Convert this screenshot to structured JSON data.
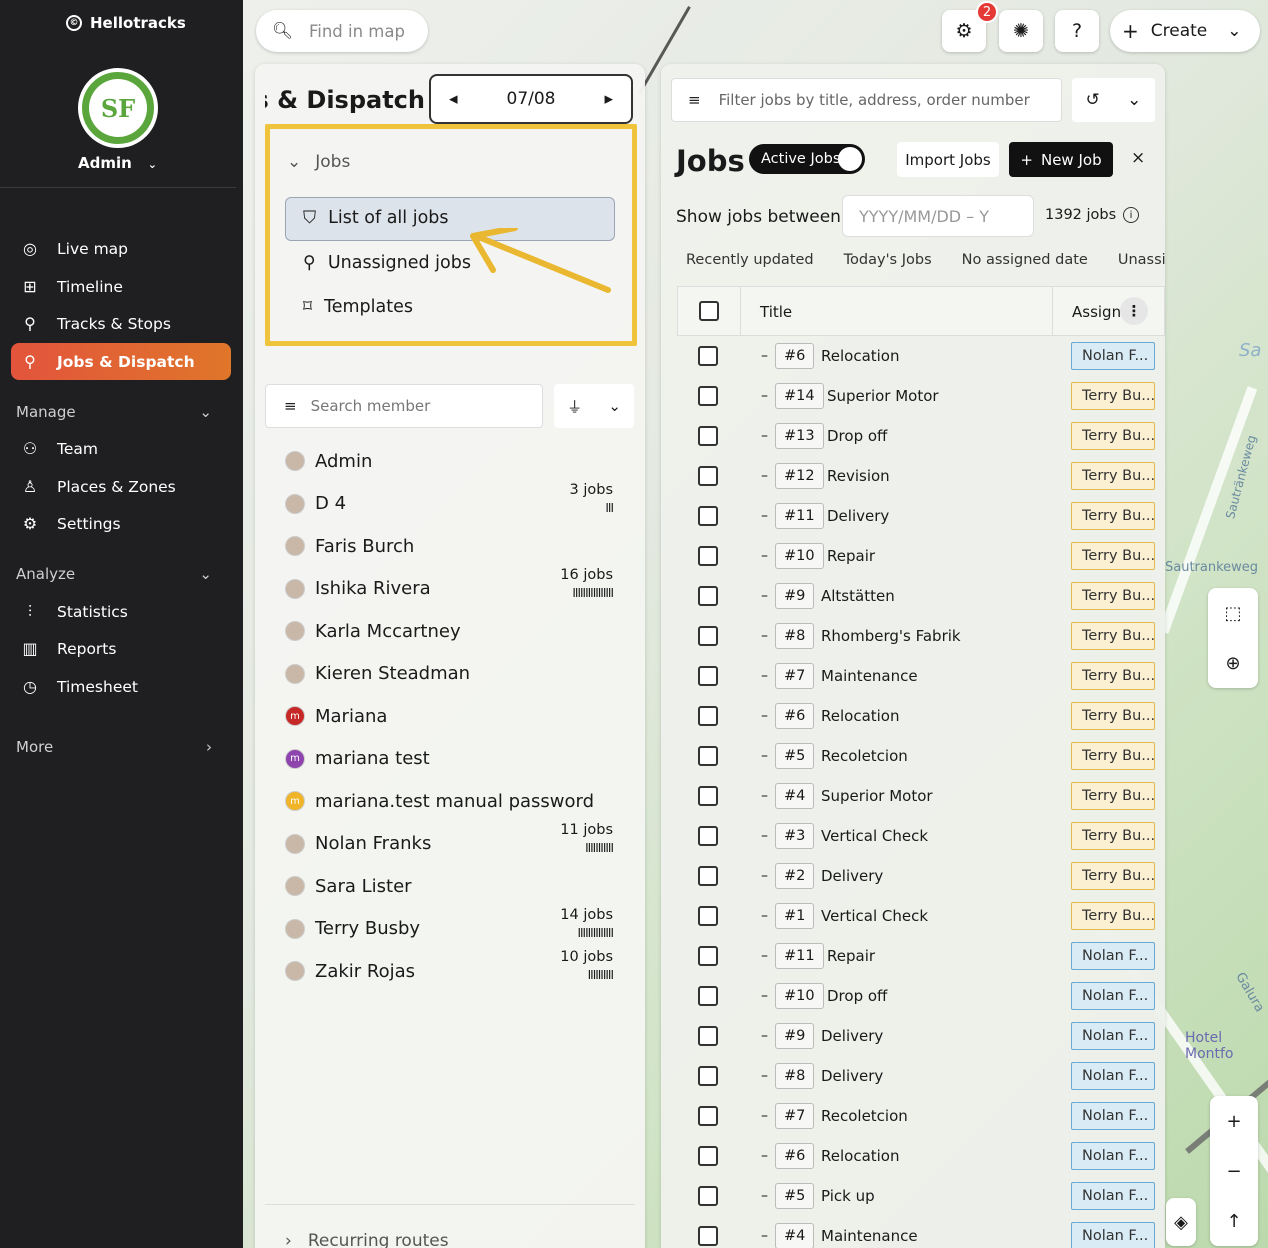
{
  "app": {
    "brand": "Hellotracks",
    "user": "Admin",
    "avatar_initials": "SF"
  },
  "sidebar": {
    "items": [
      {
        "label": "Live map",
        "icon": "live-map-icon"
      },
      {
        "label": "Timeline",
        "icon": "timeline-icon"
      },
      {
        "label": "Tracks & Stops",
        "icon": "tracks-icon"
      },
      {
        "label": "Jobs & Dispatch",
        "icon": "jobs-icon"
      }
    ],
    "manage_label": "Manage",
    "manage_items": [
      {
        "label": "Team",
        "icon": "team-icon"
      },
      {
        "label": "Places & Zones",
        "icon": "places-icon"
      },
      {
        "label": "Settings",
        "icon": "gear-icon"
      }
    ],
    "analyze_label": "Analyze",
    "analyze_items": [
      {
        "label": "Statistics",
        "icon": "statistics-icon"
      },
      {
        "label": "Reports",
        "icon": "reports-icon"
      },
      {
        "label": "Timesheet",
        "icon": "timesheet-icon"
      }
    ],
    "more_label": "More"
  },
  "topbar": {
    "search_placeholder": "Find in map",
    "notif_count": "2",
    "help": "?",
    "create_label": "Create"
  },
  "left_panel": {
    "title": "Jobs & Dispatch",
    "date": "07/08",
    "jobs_section": "Jobs",
    "menu": [
      "List of all jobs",
      "Unassigned jobs",
      "Templates"
    ],
    "search_placeholder": "Search member",
    "members": [
      {
        "name": "Admin",
        "jobs": ""
      },
      {
        "name": "D 4",
        "jobs": "3 jobs",
        "bars": "III"
      },
      {
        "name": "Faris Burch",
        "jobs": ""
      },
      {
        "name": "Ishika Rivera",
        "jobs": "16 jobs",
        "bars": "IIIIIIIIIIIIIIII"
      },
      {
        "name": "Karla Mccartney",
        "jobs": ""
      },
      {
        "name": "Kieren Steadman",
        "jobs": ""
      },
      {
        "name": "Mariana",
        "jobs": "",
        "initial": "m",
        "color": "#c62828"
      },
      {
        "name": "mariana test",
        "jobs": "",
        "initial": "m",
        "color": "#8e44ad"
      },
      {
        "name": "mariana.test manual password",
        "jobs": "",
        "initial": "m",
        "color": "#f0b429"
      },
      {
        "name": "Nolan Franks",
        "jobs": "11 jobs",
        "bars": "IIIIIIIIIII"
      },
      {
        "name": "Sara Lister",
        "jobs": ""
      },
      {
        "name": "Terry Busby",
        "jobs": "14 jobs",
        "bars": "IIIIIIIIIIIIII"
      },
      {
        "name": "Zakir Rojas",
        "jobs": "10 jobs",
        "bars": "IIIIIIIIII"
      }
    ],
    "recurring": "Recurring routes"
  },
  "right_panel": {
    "filter_placeholder": "Filter jobs by title, address, order number",
    "title": "Jobs",
    "toggle": "Active Jobs",
    "import": "Import Jobs",
    "new_job": "New Job",
    "show_between": "Show jobs between",
    "date_placeholder": "YYYY/MM/DD – Y",
    "count": "1392 jobs",
    "tabs": [
      "Recently updated",
      "Today's Jobs",
      "No assigned date",
      "Unassigne"
    ],
    "columns": {
      "title": "Title",
      "assign": "Assign"
    },
    "rows": [
      {
        "num": "#6",
        "title": "Relocation",
        "assignee": "Nolan F...",
        "who": "nolan"
      },
      {
        "num": "#14",
        "title": "Superior Motor",
        "assignee": "Terry Bu...",
        "who": "terry"
      },
      {
        "num": "#13",
        "title": "Drop off",
        "assignee": "Terry Bu...",
        "who": "terry"
      },
      {
        "num": "#12",
        "title": "Revision",
        "assignee": "Terry Bu...",
        "who": "terry"
      },
      {
        "num": "#11",
        "title": "Delivery",
        "assignee": "Terry Bu...",
        "who": "terry"
      },
      {
        "num": "#10",
        "title": "Repair",
        "assignee": "Terry Bu...",
        "who": "terry"
      },
      {
        "num": "#9",
        "title": "Altstätten",
        "assignee": "Terry Bu...",
        "who": "terry"
      },
      {
        "num": "#8",
        "title": "Rhomberg's Fabrik",
        "assignee": "Terry Bu...",
        "who": "terry"
      },
      {
        "num": "#7",
        "title": "Maintenance",
        "assignee": "Terry Bu...",
        "who": "terry"
      },
      {
        "num": "#6",
        "title": "Relocation",
        "assignee": "Terry Bu...",
        "who": "terry"
      },
      {
        "num": "#5",
        "title": "Recoletcion",
        "assignee": "Terry Bu...",
        "who": "terry"
      },
      {
        "num": "#4",
        "title": "Superior Motor",
        "assignee": "Terry Bu...",
        "who": "terry"
      },
      {
        "num": "#3",
        "title": "Vertical Check",
        "assignee": "Terry Bu...",
        "who": "terry"
      },
      {
        "num": "#2",
        "title": "Delivery",
        "assignee": "Terry Bu...",
        "who": "terry"
      },
      {
        "num": "#1",
        "title": "Vertical Check",
        "assignee": "Terry Bu...",
        "who": "terry"
      },
      {
        "num": "#11",
        "title": "Repair",
        "assignee": "Nolan F...",
        "who": "nolan"
      },
      {
        "num": "#10",
        "title": "Drop off",
        "assignee": "Nolan F...",
        "who": "nolan"
      },
      {
        "num": "#9",
        "title": "Delivery",
        "assignee": "Nolan F...",
        "who": "nolan"
      },
      {
        "num": "#8",
        "title": "Delivery",
        "assignee": "Nolan F...",
        "who": "nolan"
      },
      {
        "num": "#7",
        "title": "Recoletcion",
        "assignee": "Nolan F...",
        "who": "nolan"
      },
      {
        "num": "#6",
        "title": "Relocation",
        "assignee": "Nolan F...",
        "who": "nolan"
      },
      {
        "num": "#5",
        "title": "Pick up",
        "assignee": "Nolan F...",
        "who": "nolan"
      },
      {
        "num": "#4",
        "title": "Maintenance",
        "assignee": "Nolan F...",
        "who": "nolan"
      }
    ]
  },
  "map_labels": [
    "Sautränkeweg",
    "Sautrankeweg",
    "Hotel Montfo",
    "Galura",
    "Sa"
  ],
  "colors": {
    "accent": "#e0622f",
    "highlight": "#f0c33c",
    "nolan": "#d9ecf6",
    "terry": "#fbf1d2"
  }
}
